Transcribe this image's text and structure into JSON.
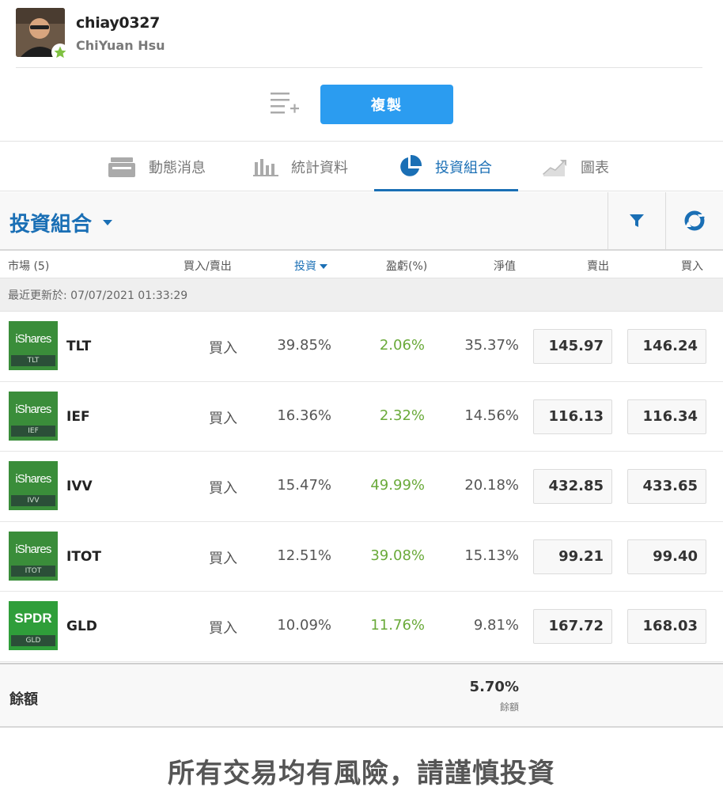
{
  "profile": {
    "username": "chiay0327",
    "real_name": "ChiYuan Hsu"
  },
  "actions": {
    "copy_label": "複製"
  },
  "tabs": [
    {
      "label": "動態消息",
      "icon": "newsfeed-icon"
    },
    {
      "label": "統計資料",
      "icon": "stats-icon"
    },
    {
      "label": "投資組合",
      "icon": "pie-chart-icon",
      "active": true
    },
    {
      "label": "圖表",
      "icon": "chart-icon"
    }
  ],
  "portfolio": {
    "title": "投資組合",
    "columns": {
      "market": "市場 (5)",
      "buy_sell": "買入/賣出",
      "invested": "投資",
      "pl": "盈虧(%)",
      "value": "淨值",
      "sell": "賣出",
      "buy": "買入"
    },
    "last_updated": "最近更新於: 07/07/2021 01:33:29",
    "rows": [
      {
        "logo": "iShares",
        "logo_ticker": "TLT",
        "symbol": "TLT",
        "side": "買入",
        "invested": "39.85%",
        "pl": "2.06%",
        "value": "35.37%",
        "sell": "145.97",
        "buy": "146.24"
      },
      {
        "logo": "iShares",
        "logo_ticker": "IEF",
        "symbol": "IEF",
        "side": "買入",
        "invested": "16.36%",
        "pl": "2.32%",
        "value": "14.56%",
        "sell": "116.13",
        "buy": "116.34"
      },
      {
        "logo": "iShares",
        "logo_ticker": "IVV",
        "symbol": "IVV",
        "side": "買入",
        "invested": "15.47%",
        "pl": "49.99%",
        "value": "20.18%",
        "sell": "432.85",
        "buy": "433.65"
      },
      {
        "logo": "iShares",
        "logo_ticker": "ITOT",
        "symbol": "ITOT",
        "side": "買入",
        "invested": "12.51%",
        "pl": "39.08%",
        "value": "15.13%",
        "sell": "99.21",
        "buy": "99.40"
      },
      {
        "logo": "SPDR",
        "logo_ticker": "GLD",
        "symbol": "GLD",
        "side": "買入",
        "invested": "10.09%",
        "pl": "11.76%",
        "value": "9.81%",
        "sell": "167.72",
        "buy": "168.03"
      }
    ],
    "balance": {
      "label": "餘額",
      "value": "5.70%",
      "sub_label": "餘額"
    }
  },
  "disclaimer": "所有交易均有風險，請謹慎投資",
  "colors": {
    "accent": "#1a6fb5",
    "button": "#2b9cf0",
    "positive": "#6aaa3a",
    "logo_green": "#3a8d3a"
  }
}
